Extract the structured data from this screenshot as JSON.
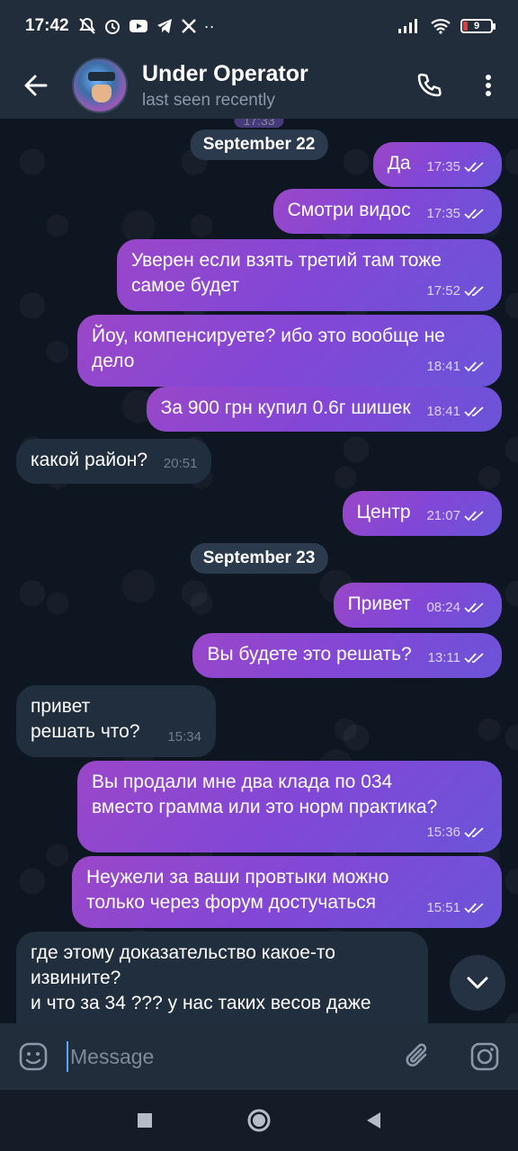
{
  "status_bar": {
    "time": "17:42",
    "battery": "9"
  },
  "header": {
    "contact_name": "Under Operator",
    "status": "last seen recently"
  },
  "chat": {
    "peek_time": "17:33",
    "dates": [
      "September 22",
      "September 23"
    ],
    "messages": [
      {
        "dir": "out",
        "text": "Да",
        "time": "17:35"
      },
      {
        "dir": "out",
        "text": "Смотри видос",
        "time": "17:35"
      },
      {
        "dir": "out",
        "text": "Уверен если взять третий там тоже\nсамое будет",
        "time": "17:52"
      },
      {
        "dir": "out",
        "text": "Йоу, компенсируете? ибо это вообще не\nдело",
        "time": "18:41"
      },
      {
        "dir": "out",
        "text": "За 900 грн купил 0.6г шишек",
        "time": "18:41"
      },
      {
        "dir": "in",
        "text": "какой район?",
        "time": "20:51"
      },
      {
        "dir": "out",
        "text": "Центр",
        "time": "21:07"
      },
      {
        "dir": "out",
        "text": "Привет",
        "time": "08:24"
      },
      {
        "dir": "out",
        "text": "Вы будете это решать?",
        "time": "13:11"
      },
      {
        "dir": "in",
        "text": "привет\nрешать что?",
        "time": "15:34"
      },
      {
        "dir": "out",
        "text": "Вы продали мне два клада по 034\nвместо грамма или это норм практика?",
        "time": "15:36"
      },
      {
        "dir": "out",
        "text": "Неужели за ваши провтыки можно\nтолько через форум достучаться",
        "time": "15:51"
      },
      {
        "dir": "in",
        "text": "где этому доказательство какое-то\nизвините?\nи что за 34 ??? у нас таких весов даже",
        "time": ""
      }
    ]
  },
  "composer": {
    "placeholder": "Message"
  },
  "colors": {
    "outgoing_bubble": "#8a47d2",
    "incoming_bubble": "#212e3d",
    "header_bg": "#222d3c",
    "chat_bg": "#0e1621"
  },
  "icons": {
    "back": "arrow-left-icon",
    "call": "phone-icon",
    "menu": "more-vert-icon",
    "emoji": "emoji-icon",
    "attach": "paperclip-icon",
    "camera": "instagram-camera-icon",
    "scroll": "chevron-down-icon"
  }
}
